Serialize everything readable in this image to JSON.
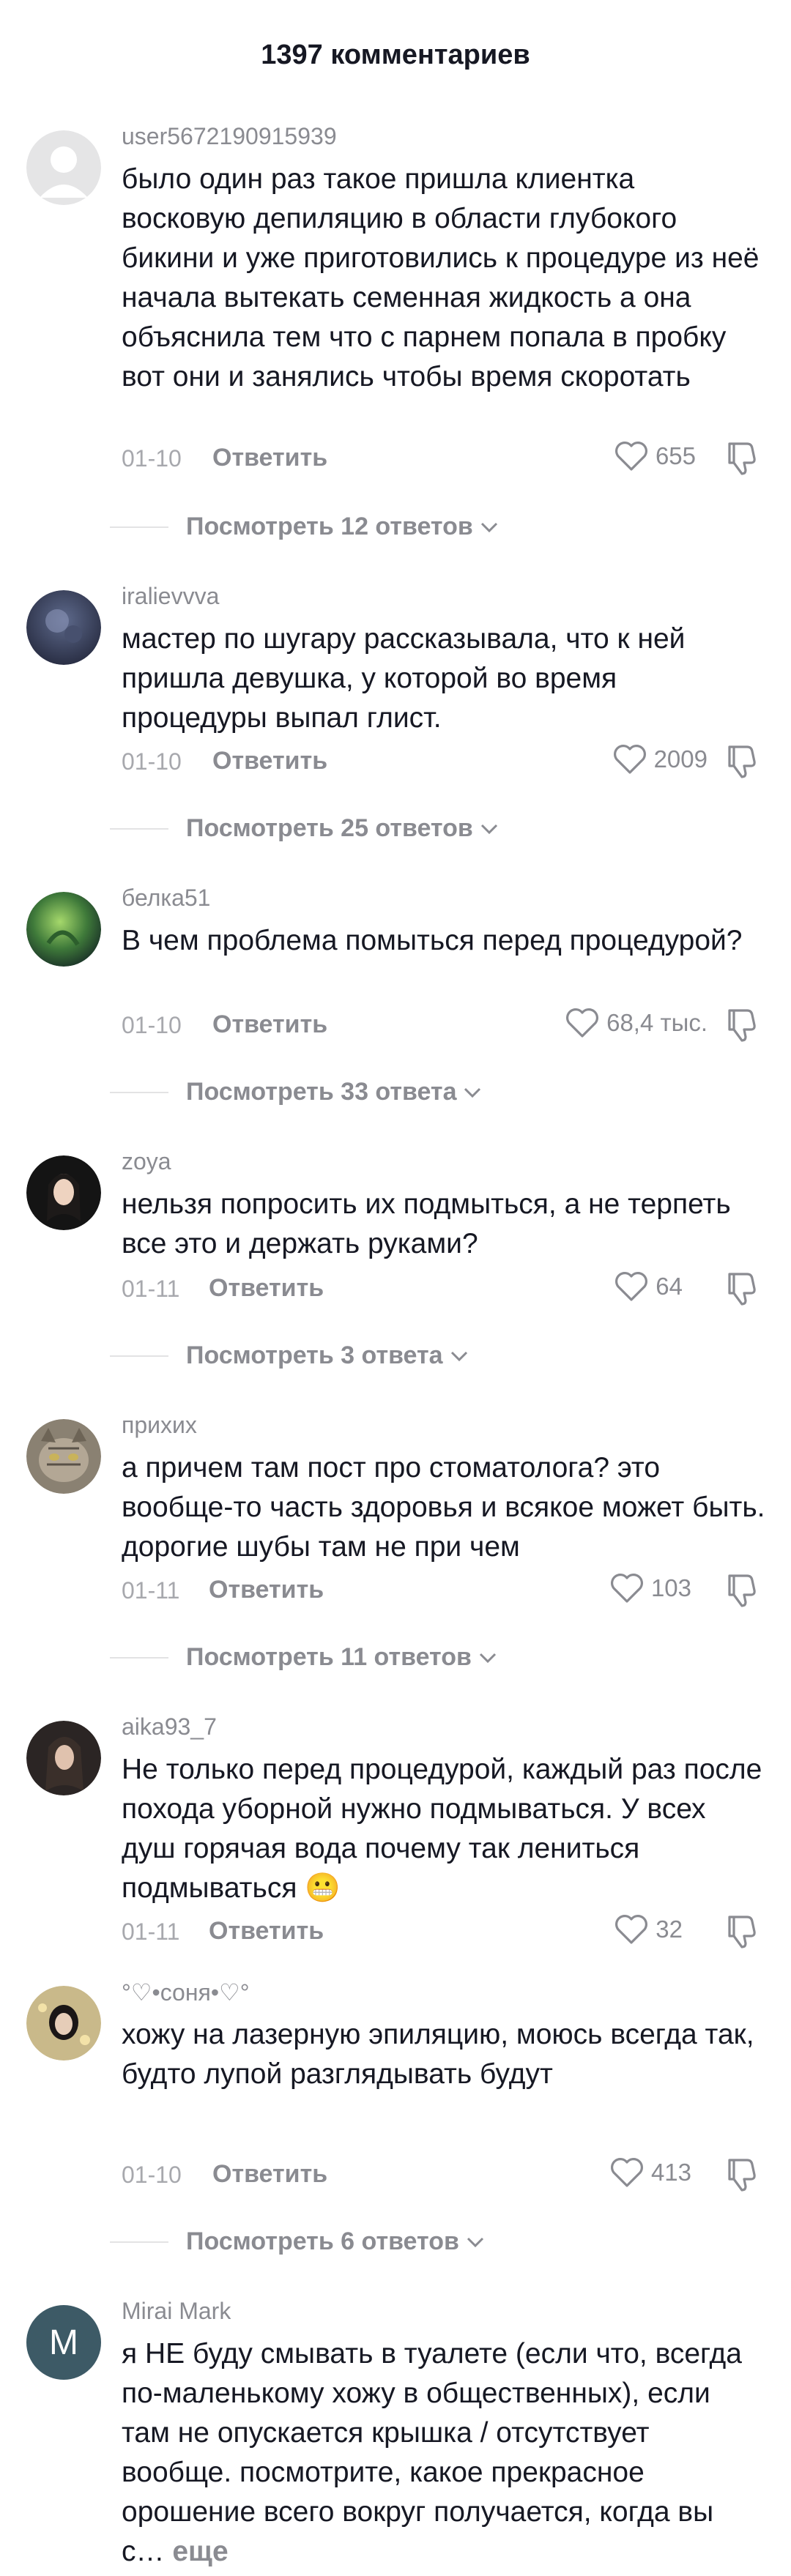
{
  "header": {
    "title": "1397 комментариев"
  },
  "ui": {
    "reply_label": "Ответить",
    "more_label": "еще"
  },
  "comments": [
    {
      "username": "user5672190915939",
      "text": "было один раз такое пришла клиентка восковую депиляцию в области глубокого бикини и уже приготовились к процедуре из неё начала вытекать семенная жидкость а она объяснила тем что с парнем попала в пробку вот они и занялись чтобы время скоротать",
      "date": "01-10",
      "likes": "655",
      "view_replies": "Посмотреть 12 ответов",
      "avatar": "default-user-avatar"
    },
    {
      "username": "iralievvva",
      "text": "мастер по шугару рассказывала, что к ней пришла девушка, у которой во время процедуры выпал глист.",
      "date": "01-10",
      "likes": "2009",
      "view_replies": "Посмотреть 25 ответов",
      "avatar": "photo-avatar"
    },
    {
      "username": "белка51",
      "text": "В чем проблема помыться перед процедурой?",
      "date": "01-10",
      "likes": "68,4 тыс.",
      "view_replies": "Посмотреть 33 ответа",
      "avatar": "photo-avatar"
    },
    {
      "username": "zoya",
      "text": "нельзя попросить их подмыться, а не терпеть все это и держать руками?",
      "date": "01-11",
      "likes": "64",
      "view_replies": "Посмотреть 3 ответа",
      "avatar": "photo-avatar"
    },
    {
      "username": "прихих",
      "text": "а причем там пост про стоматолога? это вообще-то часть здоровья и всякое может быть. дорогие шубы там не при чем",
      "date": "01-11",
      "likes": "103",
      "view_replies": "Посмотреть 11 ответов",
      "avatar": "cat-photo-avatar"
    },
    {
      "username": "aika93_7",
      "text": "Не только перед процедурой, каждый раз после похода уборной нужно подмываться. У всех душ горячая вода почему так лениться подмываться",
      "emoji": "😬",
      "date": "01-11",
      "likes": "32",
      "view_replies": "",
      "avatar": "photo-avatar"
    },
    {
      "username": "°♡•соня•♡°",
      "text": "хожу на лазерную эпиляцию, моюсь всегда так, будто лупой разглядывать будут",
      "date": "01-10",
      "likes": "413",
      "view_replies": "Посмотреть 6 ответов",
      "avatar": "photo-avatar"
    },
    {
      "username": "Mirai Mark",
      "text": "я НЕ буду смывать в туалете (если что, всегда по-маленькому хожу в общественных), если там не опускается крышка / отсутствует вообще. посмотрите, какое прекрасное орошение всего вокруг получается, когда вы с…",
      "avatar_letter": "M",
      "avatar": "letter-avatar"
    }
  ],
  "colors": {
    "text_primary": "#161823",
    "text_secondary": "#8a8b91",
    "divider": "#e3e3e4",
    "letter_avatar_bg": "#3d5a66"
  }
}
